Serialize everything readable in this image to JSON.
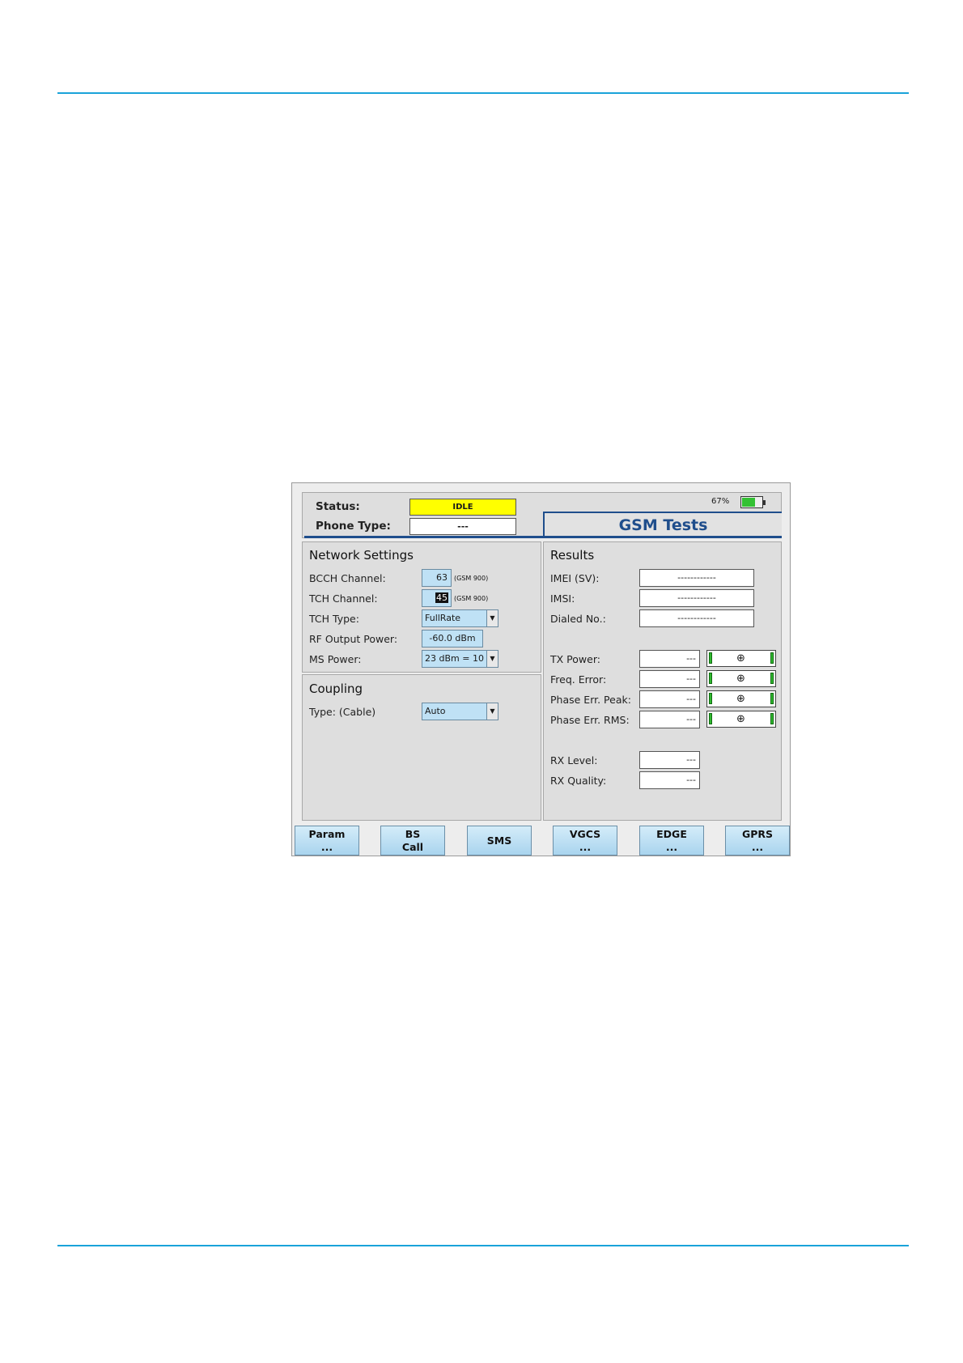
{
  "header": {
    "status_label": "Status:",
    "status_value": "IDLE",
    "phone_type_label": "Phone Type:",
    "phone_type_value": "---",
    "battery_percent": "67%",
    "battery_level": 0.67,
    "title": "GSM Tests"
  },
  "network_settings": {
    "title": "Network Settings",
    "bcch_label": "BCCH Channel:",
    "bcch_value": "63",
    "bcch_band": "(GSM 900)",
    "tch_label": "TCH Channel:",
    "tch_value": "45",
    "tch_band": "(GSM 900)",
    "tch_type_label": "TCH Type:",
    "tch_type_value": "FullRate",
    "rf_power_label": "RF Output Power:",
    "rf_power_value": "-60.0 dBm",
    "ms_power_label": "MS Power:",
    "ms_power_value": "23 dBm = 10"
  },
  "coupling": {
    "title": "Coupling",
    "type_label": "Type: (Cable)",
    "type_value": "Auto"
  },
  "results": {
    "title": "Results",
    "imei_label": "IMEI (SV):",
    "imei_value": "------------",
    "imsi_label": "IMSI:",
    "imsi_value": "------------",
    "dialed_label": "Dialed No.:",
    "dialed_value": "------------",
    "tx_power_label": "TX Power:",
    "tx_power_value": "---",
    "freq_error_label": "Freq. Error:",
    "freq_error_value": "---",
    "phase_peak_label": "Phase Err. Peak:",
    "phase_peak_value": "---",
    "phase_rms_label": "Phase Err. RMS:",
    "phase_rms_value": "---",
    "rx_level_label": "RX Level:",
    "rx_level_value": "---",
    "rx_quality_label": "RX Quality:",
    "rx_quality_value": "---",
    "gauge_marker": "⊕"
  },
  "softkeys": {
    "param_line1": "Param",
    "param_line2": "...",
    "bs_line1": "BS",
    "bs_line2": "Call",
    "sms": "SMS",
    "vgcs_line1": "VGCS",
    "vgcs_line2": "...",
    "edge_line1": "EDGE",
    "edge_line2": "...",
    "gprs_line1": "GPRS",
    "gprs_line2": "..."
  },
  "colors": {
    "rule": "#1aa3d9",
    "status_bg": "#ffff00",
    "title_blue": "#1f4e8c",
    "field_bg": "#bfe1f5"
  }
}
